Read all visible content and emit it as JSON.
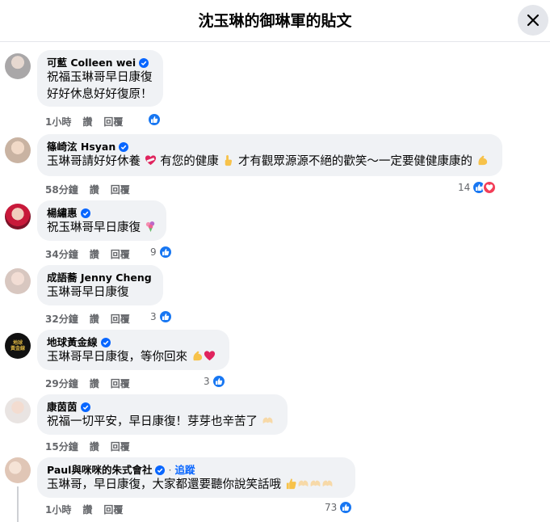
{
  "header": {
    "title": "沈玉琳的御琳軍的貼文"
  },
  "colors": {
    "like_blue": "#1877f2",
    "love_red": "#f33e58",
    "verified_blue": "#0866ff",
    "secondary_text": "#65676b",
    "bubble_bg": "#f0f2f5"
  },
  "actions": {
    "like": "讚",
    "reply": "回覆"
  },
  "comments": [
    {
      "name": "可藍 Colleen wei",
      "lines": [
        "祝福玉琳哥早日康復",
        "好好休息好好復原！"
      ],
      "time": "1小時",
      "reactions": "",
      "react_icons": [
        "like-icon"
      ]
    },
    {
      "name": "篠崎泫 Hsyan",
      "lines": [
        "玉琳哥請好好休養",
        " 有您的健康",
        "才有觀眾源源不絕的歡笑～一定要健健康康的"
      ],
      "time": "58分鐘",
      "reactions": "14",
      "react_icons": [
        "like-icon",
        "love-icon"
      ]
    },
    {
      "name": "楊繡惠",
      "lines": [
        "祝玉琳哥早日康復"
      ],
      "time": "34分鐘",
      "reactions": "9",
      "react_icons": [
        "like-icon"
      ]
    },
    {
      "name": "成語蕎 Jenny Cheng",
      "lines": [
        "玉琳哥早日康復"
      ],
      "time": "32分鐘",
      "reactions": "3",
      "react_icons": [
        "like-icon"
      ]
    },
    {
      "name": "地球黃金線",
      "lines": [
        "玉琳哥早日康復，等你回來"
      ],
      "time": "29分鐘",
      "reactions": "3",
      "react_icons": [
        "like-icon"
      ],
      "avatar_text": [
        "地球",
        "黃金線"
      ]
    },
    {
      "name": "康茵茵",
      "lines": [
        "祝福一切平安，早日康復！芽芽也辛苦了"
      ],
      "time": "15分鐘",
      "reactions": "",
      "react_icons": []
    },
    {
      "name": "Paul與咪咪的朱式會社",
      "follow_sep": "·",
      "follow": "追蹤",
      "lines": [
        "玉琳哥，早日康復，大家都還要聽你說笑話哦"
      ],
      "time": "1小時",
      "reactions": "73",
      "react_icons": [
        "like-icon"
      ]
    }
  ]
}
